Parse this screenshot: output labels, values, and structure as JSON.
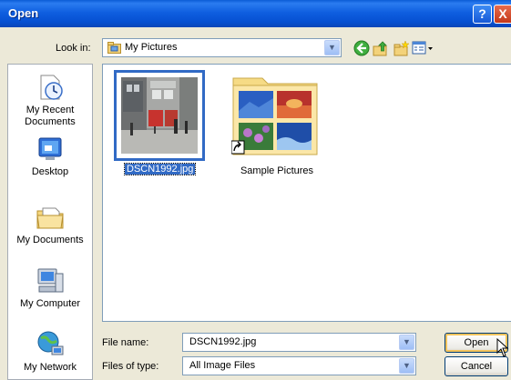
{
  "window": {
    "title": "Open"
  },
  "titlebar_buttons": {
    "help": "?",
    "close": "X"
  },
  "look_in": {
    "label": "Look in:",
    "value": "My Pictures"
  },
  "toolbar_icons": [
    "back-icon",
    "up-folder-icon",
    "new-folder-icon",
    "views-menu-icon"
  ],
  "places": [
    {
      "label": "My Recent Documents",
      "icon": "recent-documents-icon"
    },
    {
      "label": "Desktop",
      "icon": "desktop-icon"
    },
    {
      "label": "My Documents",
      "icon": "my-documents-icon"
    },
    {
      "label": "My Computer",
      "icon": "my-computer-icon"
    },
    {
      "label": "My Network",
      "icon": "my-network-icon"
    }
  ],
  "files": [
    {
      "name": "DSCN1992.jpg",
      "selected": true,
      "type": "image-thumbnail"
    },
    {
      "name": "Sample Pictures",
      "selected": false,
      "type": "folder-shortcut"
    }
  ],
  "file_name": {
    "label": "File name:",
    "value": "DSCN1992.jpg"
  },
  "file_type": {
    "label": "Files of type:",
    "value": "All Image Files"
  },
  "buttons": {
    "open": "Open",
    "cancel": "Cancel"
  },
  "colors": {
    "titlebar": "#0a5bd6",
    "selection": "#316ac5",
    "dialog_bg": "#ece9d8"
  }
}
